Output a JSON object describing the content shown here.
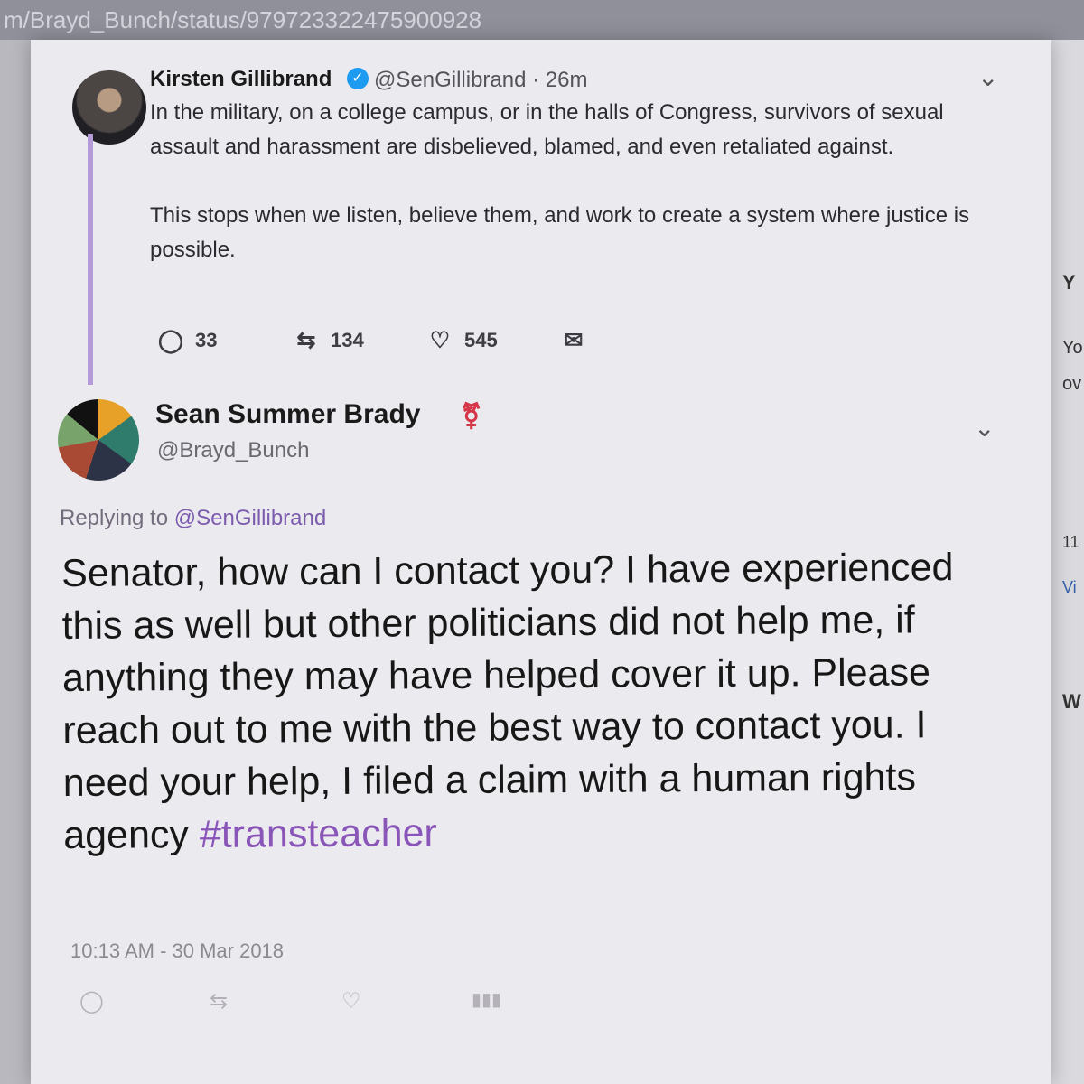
{
  "browser": {
    "url": "m/Brayd_Bunch/status/979723322475900928"
  },
  "right_panel": {
    "fragments": [
      "Y",
      "Yo",
      "ov",
      "11",
      "Vi",
      "W"
    ]
  },
  "original_tweet": {
    "display_name": "Kirsten Gillibrand",
    "handle": "@SenGillibrand",
    "separator": "·",
    "time": "26m",
    "paragraph_1": "In the military, on a college campus, or in the halls of Congress, survivors of sexual assault and harassment are disbelieved, blamed, and even retaliated against.",
    "paragraph_2": "This stops when we listen, believe them, and work to create a system where justice is possible.",
    "replies": "33",
    "retweets": "134",
    "likes": "545",
    "verified_icon": "verified-badge-icon",
    "menu_icon": "chevron-down-icon"
  },
  "reply_tweet": {
    "display_name": "Sean Summer Brady",
    "name_emoji": "transgender-symbol-icon",
    "handle": "@Brayd_Bunch",
    "replying_to_prefix": "Replying to",
    "replying_to_handle": "@SenGillibrand",
    "body": "Senator, how can I contact you? I have experienced this as well but other politicians did not help me, if anything they may have helped cover it up. Please reach out to me with the best way to contact you. I need your help, I filed a claim with a human rights agency",
    "hashtag": "#transteacher",
    "timestamp": "10:13 AM - 30 Mar 2018",
    "menu_icon": "chevron-down-icon"
  },
  "icons": {
    "reply": "reply-icon",
    "retweet": "retweet-icon",
    "like": "heart-icon",
    "message": "envelope-icon",
    "analytics": "analytics-icon"
  },
  "colors": {
    "accent": "#8a55b8",
    "thread_line": "#b49ad7",
    "verified": "#1d9bf0",
    "text": "#171717"
  }
}
